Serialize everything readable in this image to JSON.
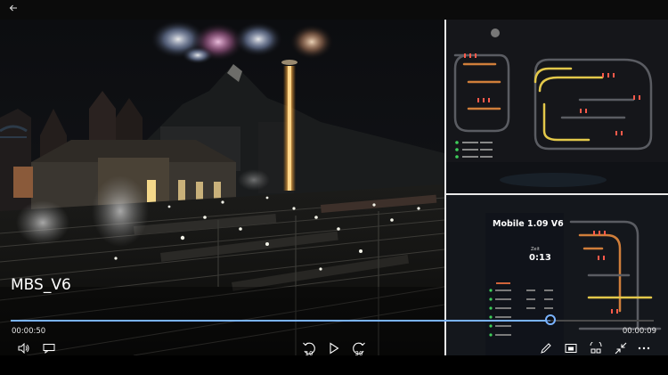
{
  "window": {
    "back_icon": "back-arrow-icon"
  },
  "video": {
    "title": "MBS_V6",
    "elapsed": "00:00:50",
    "remaining": "00:00:09",
    "progress": 0.84
  },
  "overlay": {
    "panel_title": "Mobile 1.09 V6",
    "zeit_label": "Zeit",
    "clock": "0:13"
  },
  "controls": {
    "skip_back_seconds": "10",
    "skip_forward_seconds": "30",
    "icons": [
      "volume-icon",
      "captions-icon",
      "skip-back-icon",
      "play-icon",
      "skip-forward-icon",
      "edit-icon",
      "cast-icon",
      "mini-view-icon",
      "collapse-icon",
      "more-icon"
    ]
  }
}
